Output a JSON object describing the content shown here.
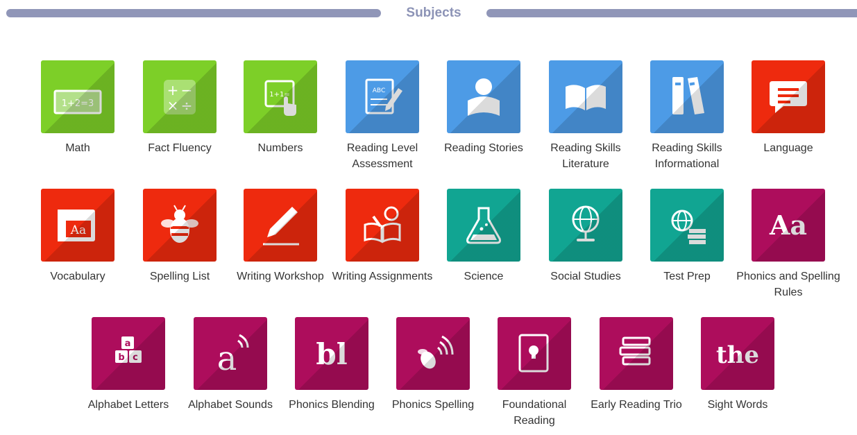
{
  "header": {
    "title": "Subjects"
  },
  "colors": {
    "green": "#7dcf28",
    "blue": "#4d9be6",
    "red": "#ee2a0e",
    "teal": "#11a592",
    "magenta": "#ad0d5c",
    "header_bar": "#9096b8"
  },
  "subjects": [
    {
      "label": "Math",
      "icon": "chalkboard-icon",
      "color": "green"
    },
    {
      "label": "Fact Fluency",
      "icon": "calculator-icon",
      "color": "green"
    },
    {
      "label": "Numbers",
      "icon": "touch-board-icon",
      "color": "green"
    },
    {
      "label": "Reading Level Assessment",
      "icon": "notebook-pencil-icon",
      "color": "blue"
    },
    {
      "label": "Reading Stories",
      "icon": "person-reading-icon",
      "color": "blue"
    },
    {
      "label": "Reading Skills Literature",
      "icon": "open-book-icon",
      "color": "blue"
    },
    {
      "label": "Reading Skills Informational",
      "icon": "binders-icon",
      "color": "blue"
    },
    {
      "label": "Language",
      "icon": "speech-bubble-icon",
      "color": "red"
    },
    {
      "label": "Vocabulary",
      "icon": "dictionary-icon",
      "color": "red"
    },
    {
      "label": "Spelling List",
      "icon": "bee-icon",
      "color": "red"
    },
    {
      "label": "Writing Workshop",
      "icon": "pencil-icon",
      "color": "red"
    },
    {
      "label": "Writing Assignments",
      "icon": "book-writing-icon",
      "color": "red"
    },
    {
      "label": "Science",
      "icon": "flask-icon",
      "color": "teal"
    },
    {
      "label": "Social Studies",
      "icon": "globe-icon",
      "color": "teal"
    },
    {
      "label": "Test Prep",
      "icon": "globe-books-icon",
      "color": "teal"
    },
    {
      "label": "Phonics and Spelling Rules",
      "icon": "aa-letters-icon",
      "color": "magenta",
      "glyph": "Aa"
    },
    {
      "label": "Alphabet Letters",
      "icon": "letter-blocks-icon",
      "color": "magenta",
      "glyph_blocks": [
        "a",
        "b",
        "c"
      ]
    },
    {
      "label": "Alphabet Sounds",
      "icon": "letter-a-sound-icon",
      "color": "magenta",
      "glyph": "a"
    },
    {
      "label": "Phonics Blending",
      "icon": "bl-letters-icon",
      "color": "magenta",
      "glyph": "bl"
    },
    {
      "label": "Phonics Spelling",
      "icon": "bee-sound-icon",
      "color": "magenta"
    },
    {
      "label": "Foundational Reading",
      "icon": "lightbulb-book-icon",
      "color": "magenta"
    },
    {
      "label": "Early Reading Trio",
      "icon": "book-stack-icon",
      "color": "magenta"
    },
    {
      "label": "Sight Words",
      "icon": "the-word-icon",
      "color": "magenta",
      "glyph": "the"
    }
  ]
}
